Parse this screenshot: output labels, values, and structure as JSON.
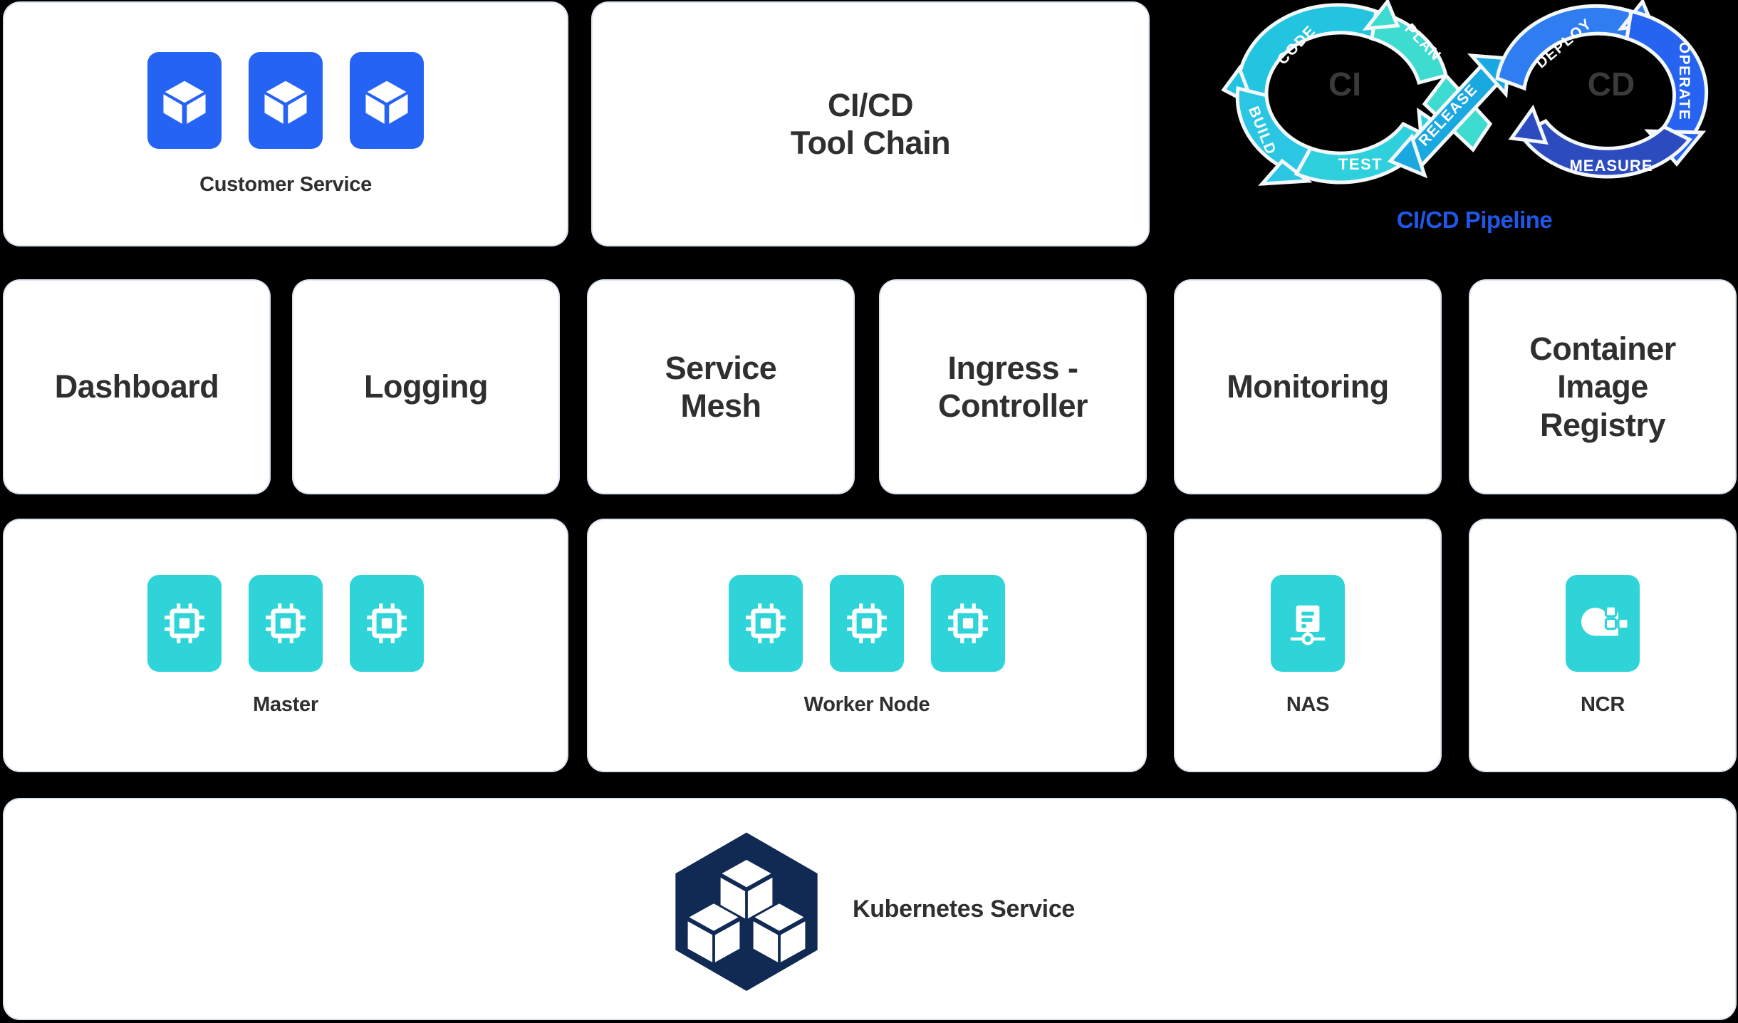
{
  "background_color": "#000000",
  "palette": {
    "card_bg": "#ffffff",
    "card_border": "#dbe4f0",
    "service_blue": "#2563f5",
    "node_teal": "#2fd4d8",
    "kubernetes_navy": "#102a54",
    "pipeline_label_blue": "#2057e8",
    "text_dark": "#2f2f2f"
  },
  "row1": {
    "customer_service": {
      "label": "Customer Service",
      "icon": "cube-icon",
      "icon_count": 3
    },
    "toolchain": {
      "line1": "CI/CD",
      "line2": "Tool Chain"
    }
  },
  "pipeline": {
    "label": "CI/CD Pipeline",
    "ci_text": "CI",
    "cd_text": "CD",
    "stages": [
      {
        "name": "CODE",
        "loop": "CI",
        "color": "#22c4e0"
      },
      {
        "name": "PLAN",
        "loop": "CI",
        "color": "#3ddbd0"
      },
      {
        "name": "BUILD",
        "loop": "CI",
        "color": "#22c4e0"
      },
      {
        "name": "TEST",
        "loop": "CI",
        "color": "#2fd0dd"
      },
      {
        "name": "RELEASE",
        "loop": "BRIDGE",
        "color": "#1aa8e0"
      },
      {
        "name": "DEPLOY",
        "loop": "CD",
        "color": "#2f7df0"
      },
      {
        "name": "OPERATE",
        "loop": "CD",
        "color": "#2563f0"
      },
      {
        "name": "MEASURE",
        "loop": "CD",
        "color": "#2b4bbf"
      }
    ]
  },
  "row2": {
    "cards": [
      {
        "label": "Dashboard",
        "name": "dashboard"
      },
      {
        "label": "Logging",
        "name": "logging"
      },
      {
        "label": "Service\nMesh",
        "name": "service-mesh",
        "line1": "Service",
        "line2": "Mesh"
      },
      {
        "label": "Ingress - Controller",
        "name": "ingress-controller",
        "line1": "Ingress -",
        "line2": "Controller"
      },
      {
        "label": "Monitoring",
        "name": "monitoring"
      },
      {
        "label": "Container Image Registry",
        "name": "container-image-registry",
        "line1": "Container",
        "line2": "Image",
        "line3": "Registry"
      }
    ]
  },
  "row3": {
    "master": {
      "label": "Master",
      "icon": "cpu-chip-icon",
      "icon_count": 3
    },
    "worker": {
      "label": "Worker Node",
      "icon": "cpu-chip-icon",
      "icon_count": 3
    },
    "nas": {
      "label": "NAS",
      "icon": "network-storage-icon"
    },
    "ncr": {
      "label": "NCR",
      "icon": "cloud-registry-icon"
    }
  },
  "row4": {
    "kubernetes": {
      "label": "Kubernetes Service",
      "icon": "kubernetes-hexagon-icon"
    }
  }
}
